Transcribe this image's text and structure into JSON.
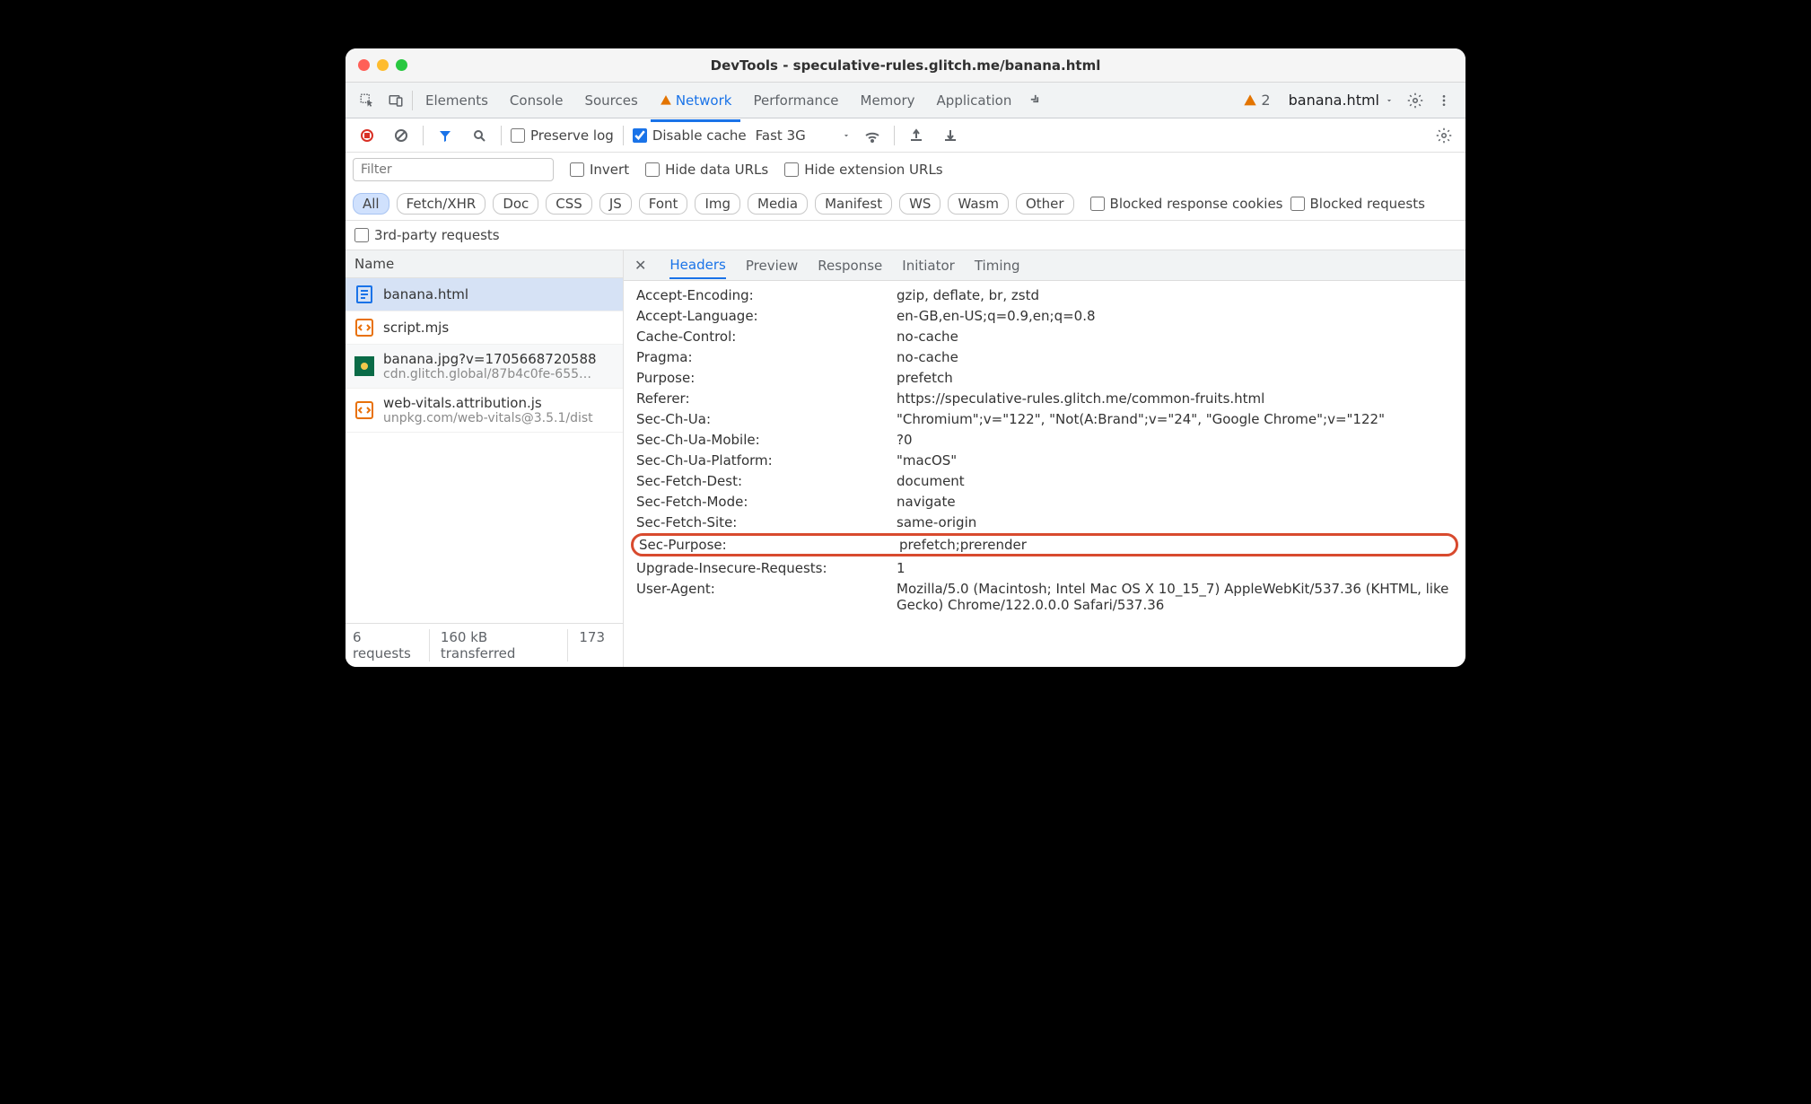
{
  "window_title": "DevTools - speculative-rules.glitch.me/banana.html",
  "tabs": [
    "Elements",
    "Console",
    "Sources",
    "Network",
    "Performance",
    "Memory",
    "Application"
  ],
  "active_tab": "Network",
  "warning_count": "2",
  "context_label": "banana.html",
  "toolbar": {
    "preserve_log": "Preserve log",
    "disable_cache": "Disable cache",
    "throttle": "Fast 3G"
  },
  "filter": {
    "placeholder": "Filter",
    "invert": "Invert",
    "hide_data": "Hide data URLs",
    "hide_ext": "Hide extension URLs",
    "types": [
      "All",
      "Fetch/XHR",
      "Doc",
      "CSS",
      "JS",
      "Font",
      "Img",
      "Media",
      "Manifest",
      "WS",
      "Wasm",
      "Other"
    ],
    "blocked_cookies": "Blocked response cookies",
    "blocked_req": "Blocked requests",
    "third_party": "3rd-party requests"
  },
  "left_header": "Name",
  "requests": [
    {
      "name": "banana.html",
      "sub": "",
      "type": "doc"
    },
    {
      "name": "script.mjs",
      "sub": "",
      "type": "js"
    },
    {
      "name": "banana.jpg?v=1705668720588",
      "sub": "cdn.glitch.global/87b4c0fe-655…",
      "type": "img"
    },
    {
      "name": "web-vitals.attribution.js",
      "sub": "unpkg.com/web-vitals@3.5.1/dist",
      "type": "js"
    }
  ],
  "status": {
    "requests": "6 requests",
    "transfer": "160 kB transferred",
    "extra": "173"
  },
  "detail_tabs": [
    "Headers",
    "Preview",
    "Response",
    "Initiator",
    "Timing"
  ],
  "headers": [
    {
      "k": "Accept-Encoding:",
      "v": "gzip, deflate, br, zstd"
    },
    {
      "k": "Accept-Language:",
      "v": "en-GB,en-US;q=0.9,en;q=0.8"
    },
    {
      "k": "Cache-Control:",
      "v": "no-cache"
    },
    {
      "k": "Pragma:",
      "v": "no-cache"
    },
    {
      "k": "Purpose:",
      "v": "prefetch"
    },
    {
      "k": "Referer:",
      "v": "https://speculative-rules.glitch.me/common-fruits.html"
    },
    {
      "k": "Sec-Ch-Ua:",
      "v": "\"Chromium\";v=\"122\", \"Not(A:Brand\";v=\"24\", \"Google Chrome\";v=\"122\""
    },
    {
      "k": "Sec-Ch-Ua-Mobile:",
      "v": "?0"
    },
    {
      "k": "Sec-Ch-Ua-Platform:",
      "v": "\"macOS\""
    },
    {
      "k": "Sec-Fetch-Dest:",
      "v": "document"
    },
    {
      "k": "Sec-Fetch-Mode:",
      "v": "navigate"
    },
    {
      "k": "Sec-Fetch-Site:",
      "v": "same-origin"
    },
    {
      "k": "Sec-Purpose:",
      "v": "prefetch;prerender",
      "hl": true
    },
    {
      "k": "Upgrade-Insecure-Requests:",
      "v": "1"
    },
    {
      "k": "User-Agent:",
      "v": "Mozilla/5.0 (Macintosh; Intel Mac OS X 10_15_7) AppleWebKit/537.36 (KHTML, like Gecko) Chrome/122.0.0.0 Safari/537.36"
    }
  ]
}
